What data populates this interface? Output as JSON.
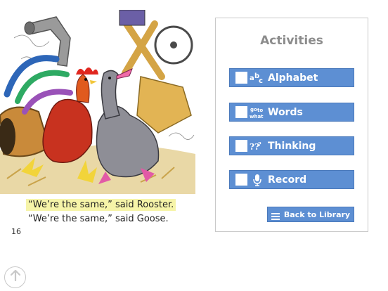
{
  "story": {
    "line1": "“We’re the same,” said Rooster.",
    "line2": "“We’re the same,” said Goose.",
    "page_number": "16"
  },
  "panel": {
    "title": "Activities",
    "activities": [
      {
        "label": "Alphabet",
        "icon": "abc-letters-icon",
        "checked": false
      },
      {
        "label": "Words",
        "icon": "go-to-what-words-icon",
        "checked": false
      },
      {
        "label": "Thinking",
        "icon": "question-marks-icon",
        "checked": false
      },
      {
        "label": "Record",
        "icon": "microphone-icon",
        "checked": false
      }
    ],
    "back_label": "Back to Library",
    "back_icon": "menu-lines-icon"
  },
  "colors": {
    "button_blue": "#5d8fd3",
    "title_gray": "#8c8c8c",
    "highlight": "#f6f4a8"
  },
  "scroll_up_icon": "arrow-up-icon"
}
